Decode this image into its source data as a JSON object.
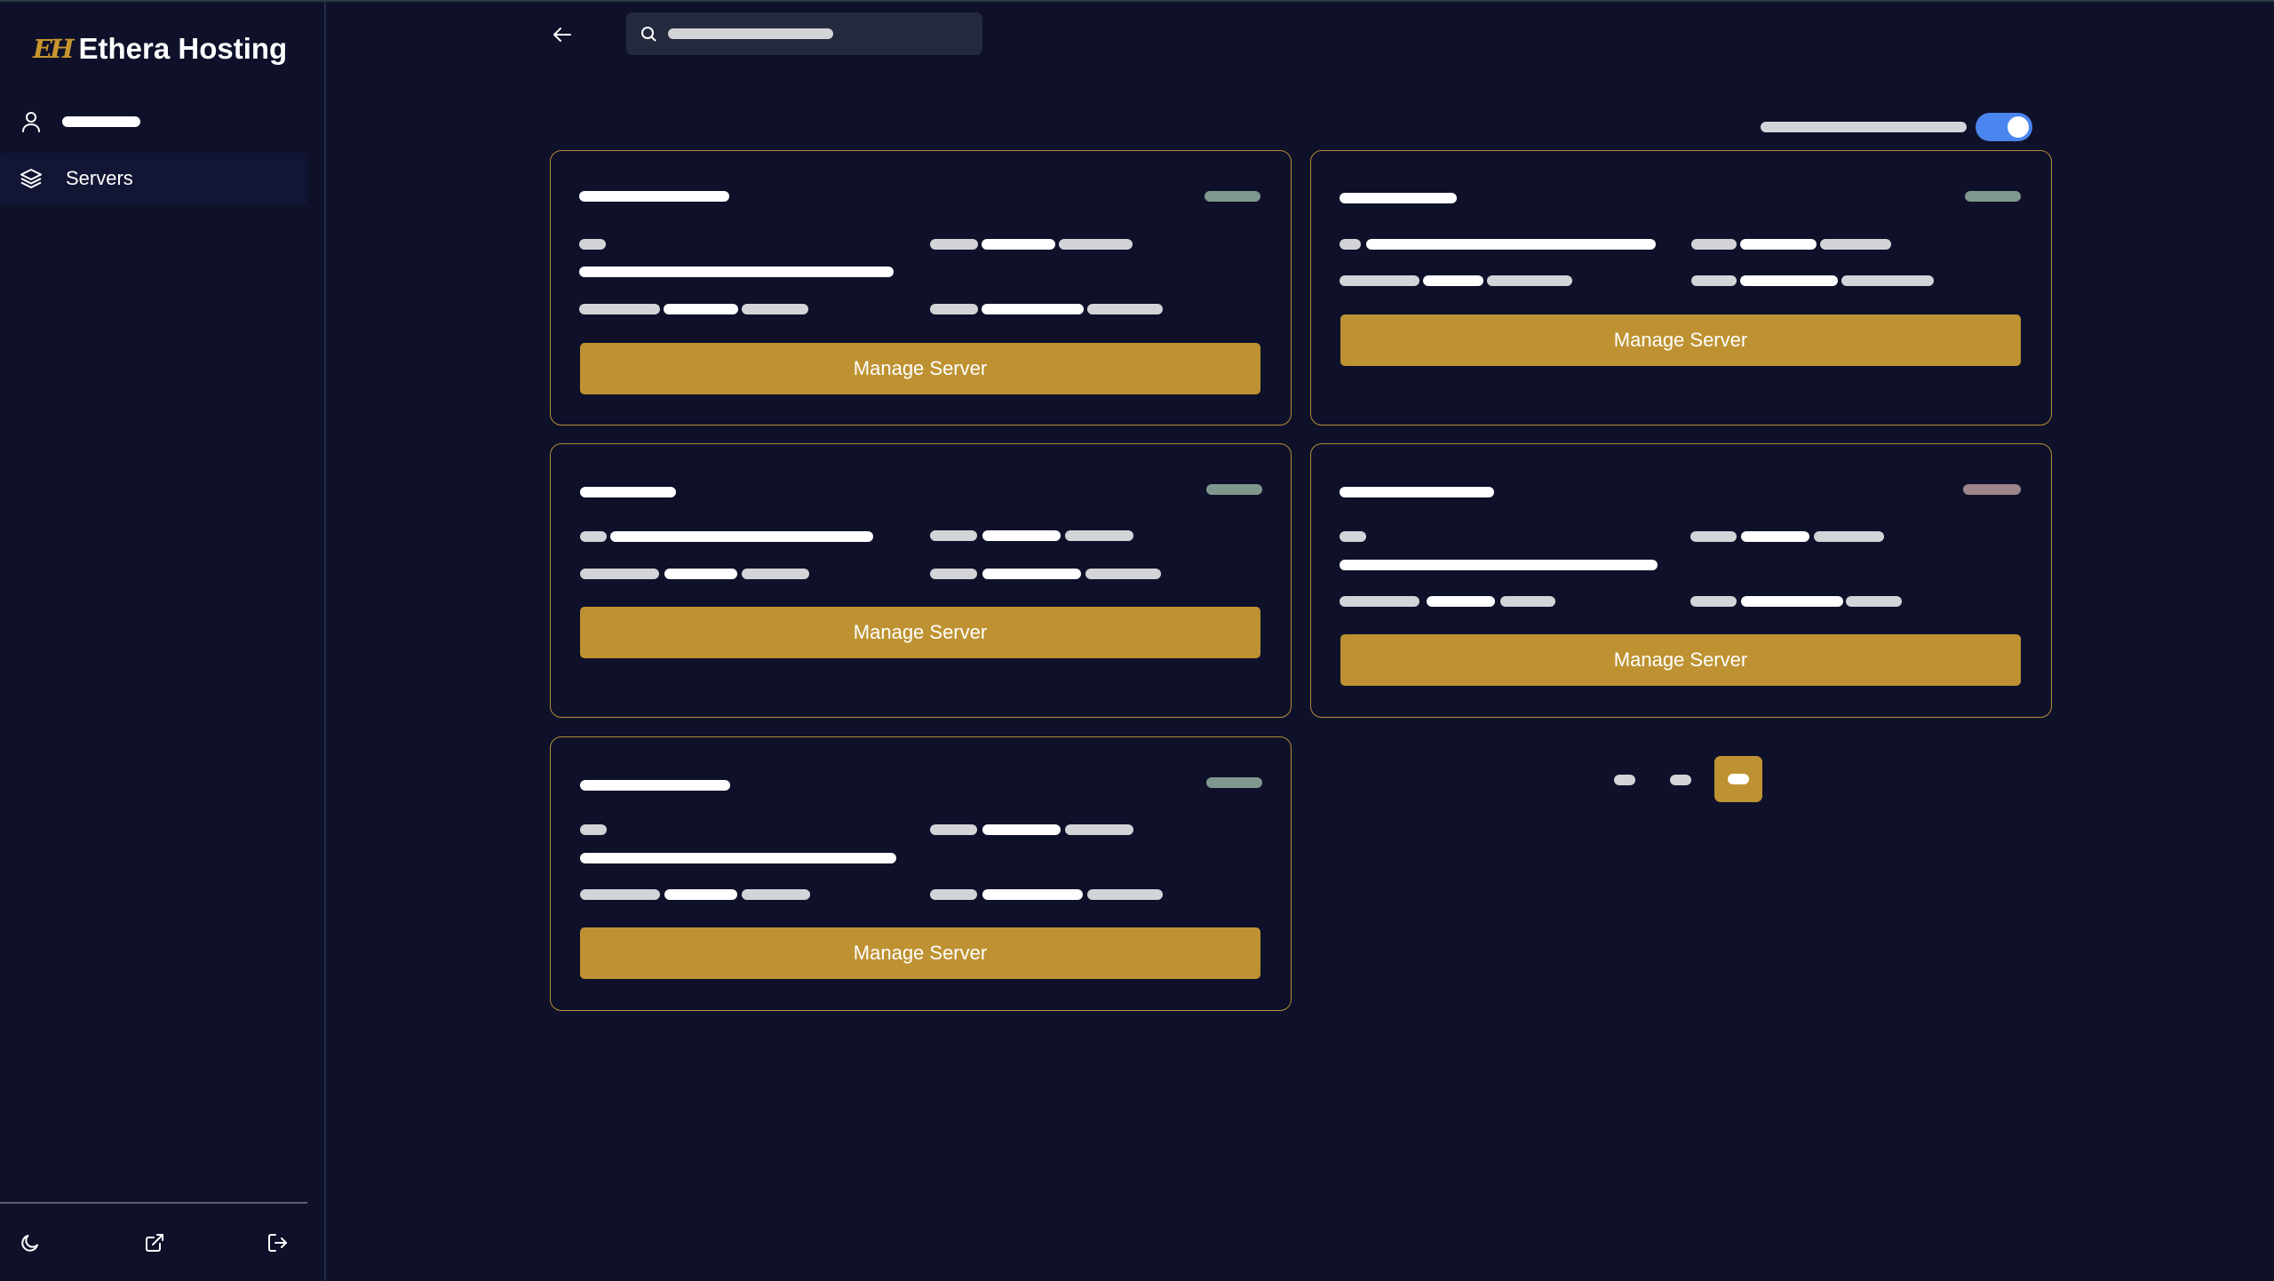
{
  "brand": {
    "mark": "EH",
    "name": "Ethera Hosting"
  },
  "sidebar": {
    "items": [
      {
        "label": "",
        "icon": "user-icon",
        "redacted": true
      },
      {
        "label": "Servers",
        "icon": "layers-icon",
        "active": true
      }
    ],
    "footer_icons": [
      "moon-icon",
      "external-link-icon",
      "logout-icon"
    ]
  },
  "topbar": {
    "back_icon": "arrow-left-icon",
    "search_icon": "search-icon",
    "search_placeholder": ""
  },
  "view_toggle": {
    "label": "",
    "enabled": true,
    "color": "#4a84ee"
  },
  "servers": [
    {
      "button": "Manage Server",
      "status_color": "#7f988e"
    },
    {
      "button": "Manage Server",
      "status_color": "#7f988e"
    },
    {
      "button": "Manage Server",
      "status_color": "#7f988e"
    },
    {
      "button": "Manage Server",
      "status_color": "#9e848b"
    },
    {
      "button": "Manage Server",
      "status_color": "#7f988e"
    }
  ],
  "pagination": {
    "pages": 3,
    "current": 3,
    "accent": "#be9232"
  },
  "colors": {
    "background": "#0e1129",
    "accent": "#be9232",
    "card_border": "#b48c37"
  }
}
